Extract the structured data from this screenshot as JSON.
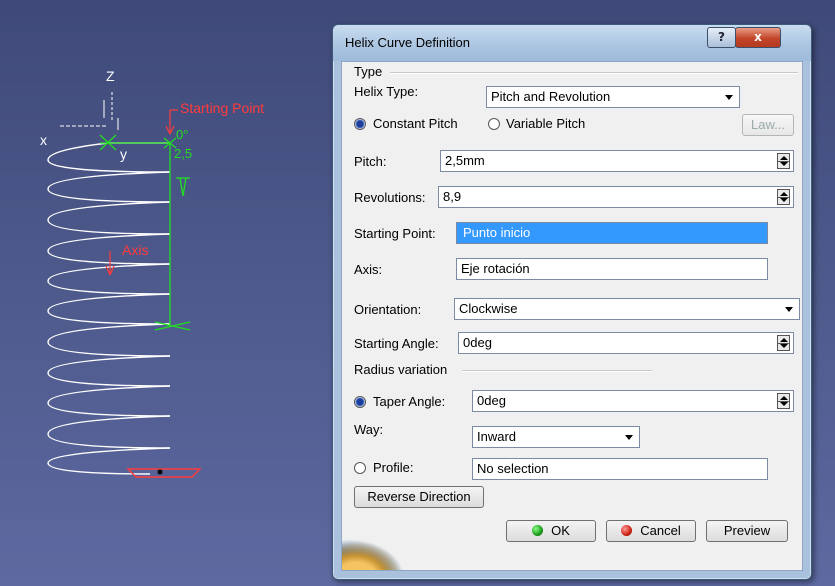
{
  "viewport": {
    "axis_z": "Z",
    "axis_x": "x",
    "axis_y": "y",
    "starting_point_label": "Starting Point",
    "axis_label": "Axis",
    "angle_label": "0°",
    "pitch_dim": "2,5"
  },
  "dialog": {
    "title": "Helix Curve Definition",
    "help_label": "?",
    "close_label": "x",
    "type_group": "Type",
    "helix_type_label": "Helix Type:",
    "helix_type_value": "Pitch and Revolution",
    "constant_pitch_label": "Constant Pitch",
    "variable_pitch_label": "Variable Pitch",
    "law_button": "Law...",
    "pitch_label": "Pitch:",
    "pitch_value": "2,5mm",
    "revolutions_label": "Revolutions:",
    "revolutions_value": "8,9",
    "starting_point_label": "Starting Point:",
    "starting_point_value": "Punto inicio",
    "axis_label": "Axis:",
    "axis_value": "Eje rotación",
    "orientation_label": "Orientation:",
    "orientation_value": "Clockwise",
    "starting_angle_label": "Starting Angle:",
    "starting_angle_value": "0deg",
    "radius_variation_group": "Radius variation",
    "taper_angle_label": "Taper Angle:",
    "taper_angle_value": "0deg",
    "way_label": "Way:",
    "way_value": "Inward",
    "profile_label": "Profile:",
    "profile_value": "No selection",
    "reverse_direction_button": "Reverse Direction",
    "ok_button": "OK",
    "cancel_button": "Cancel",
    "preview_button": "Preview"
  },
  "colors": {
    "background": "#4e5a8c",
    "helix": "#ffffff",
    "axis_green": "#22dd22",
    "label_red": "#ff3b3b",
    "selection_blue": "#3399ff"
  }
}
